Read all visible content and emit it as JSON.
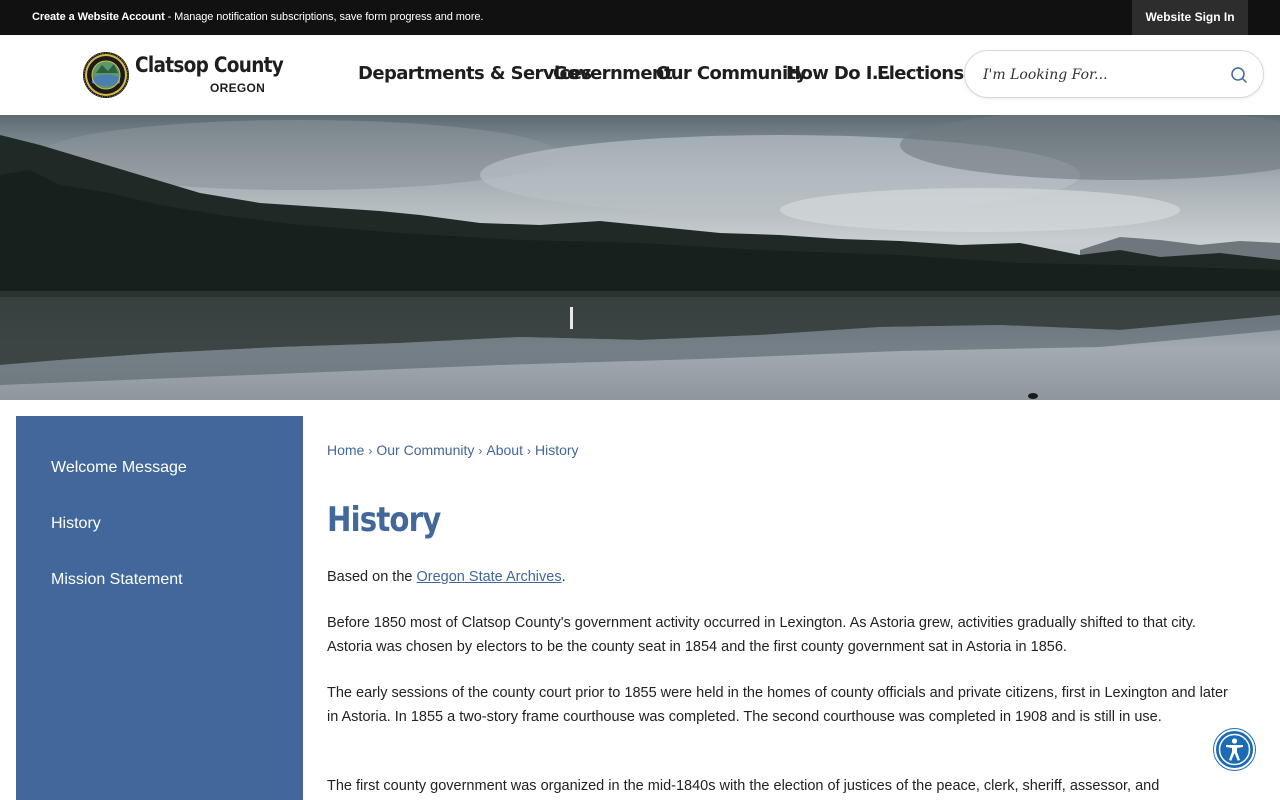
{
  "topbar": {
    "create_account": "Create a Website Account",
    "create_account_desc": " - Manage notification subscriptions, save form progress and more.",
    "sign_in": "Website Sign In"
  },
  "header": {
    "logo_name": "Clatsop County",
    "logo_sub": "OREGON",
    "nav": [
      "Departments & Services",
      "Government",
      "Our Community",
      "How Do I...",
      "Elections"
    ],
    "search_placeholder": "I'm Looking For..."
  },
  "sidebar": {
    "items": [
      {
        "label": "Welcome Message"
      },
      {
        "label": "History"
      },
      {
        "label": "Mission Statement"
      }
    ]
  },
  "breadcrumb": [
    "Home",
    "Our Community",
    "About",
    "History"
  ],
  "main": {
    "title": "History",
    "intro_prefix": "Based on the ",
    "intro_link": "Oregon State Archives",
    "intro_suffix": ".",
    "paragraphs": [
      "Before 1850 most of Clatsop County's government activity occurred in Lexington. As Astoria grew, activities gradually shifted to that city. Astoria was chosen by electors to be the county seat in 1854 and the first county government sat in Astoria in 1856.",
      "The early sessions of the county court prior to 1855 were held in the homes of county officials and private citizens, first in Lexington and later in Astoria. In 1855 a two-story frame courthouse was completed. The second courthouse was completed in 1908 and is still in use.",
      "The first county government was organized in the mid-1840s with the election of justices of the peace, clerk, sheriff, assessor, and"
    ]
  },
  "colors": {
    "brand_blue": "#42679a",
    "topbar": "#111111",
    "accessibility": "#1c6bb5"
  },
  "icons": {
    "search": "search-icon",
    "accessibility": "accessibility-icon"
  }
}
